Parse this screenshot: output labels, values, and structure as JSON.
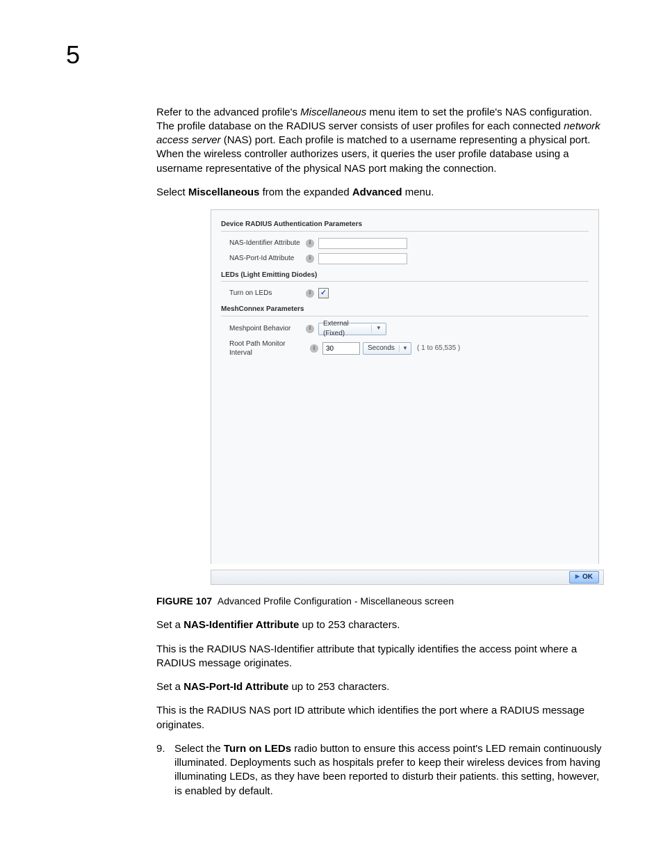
{
  "chapter_number": "5",
  "intro_para": {
    "pre_em1": "Refer to the advanced profile's ",
    "em1": "Miscellaneous",
    "mid1": " menu item to set the profile's NAS configuration. The profile database on the RADIUS server consists of user profiles for each connected ",
    "em2": "network access server",
    "post": " (NAS) port. Each profile is matched to a username representing a physical port. When the wireless controller authorizes users, it queries the user profile database using a username representative of the physical NAS port making the connection."
  },
  "select_line": {
    "pre": "Select ",
    "b1": "Miscellaneous",
    "mid": " from the expanded ",
    "b2": "Advanced",
    "post": " menu."
  },
  "screenshot": {
    "section1_title": "Device RADIUS Authentication Parameters",
    "nas_identifier_label": "NAS-Identifier Attribute",
    "nas_identifier_value": "",
    "nas_port_label": "NAS-Port-Id Attribute",
    "nas_port_value": "",
    "section2_title": "LEDs (Light Emitting Diodes)",
    "turn_on_leds_label": "Turn on LEDs",
    "turn_on_leds_checkmark": "✓",
    "section3_title": "MeshConnex Parameters",
    "meshpoint_behavior_label": "Meshpoint Behavior",
    "meshpoint_behavior_value": "External (Fixed)",
    "root_path_label": "Root Path Monitor Interval",
    "root_path_value": "30",
    "root_path_unit": "Seconds",
    "root_path_range": "( 1 to 65,535 )",
    "ok_label": "OK"
  },
  "figure_caption": {
    "label": "FIGURE 107",
    "text": "Advanced Profile Configuration - Miscellaneous screen"
  },
  "nas_id_set": {
    "pre": "Set a ",
    "b": "NAS-Identifier Attribute",
    "post": " up to 253 characters."
  },
  "nas_id_desc": "This is the RADIUS NAS-Identifier attribute that typically identifies the access point where a RADIUS message originates.",
  "nas_port_set": {
    "pre": "Set a ",
    "b": "NAS-Port-Id Attribute",
    "post": " up to 253 characters."
  },
  "nas_port_desc": "This is the RADIUS NAS port ID attribute which identifies the port where a RADIUS message originates.",
  "step9": {
    "num": "9.",
    "pre": "Select the ",
    "b": "Turn on LEDs",
    "post": " radio button to ensure this access point's LED remain continuously illuminated. Deployments such as hospitals prefer to keep their wireless devices from having illuminating LEDs, as they have been reported to disturb their patients. this setting, however, is enabled by default."
  }
}
